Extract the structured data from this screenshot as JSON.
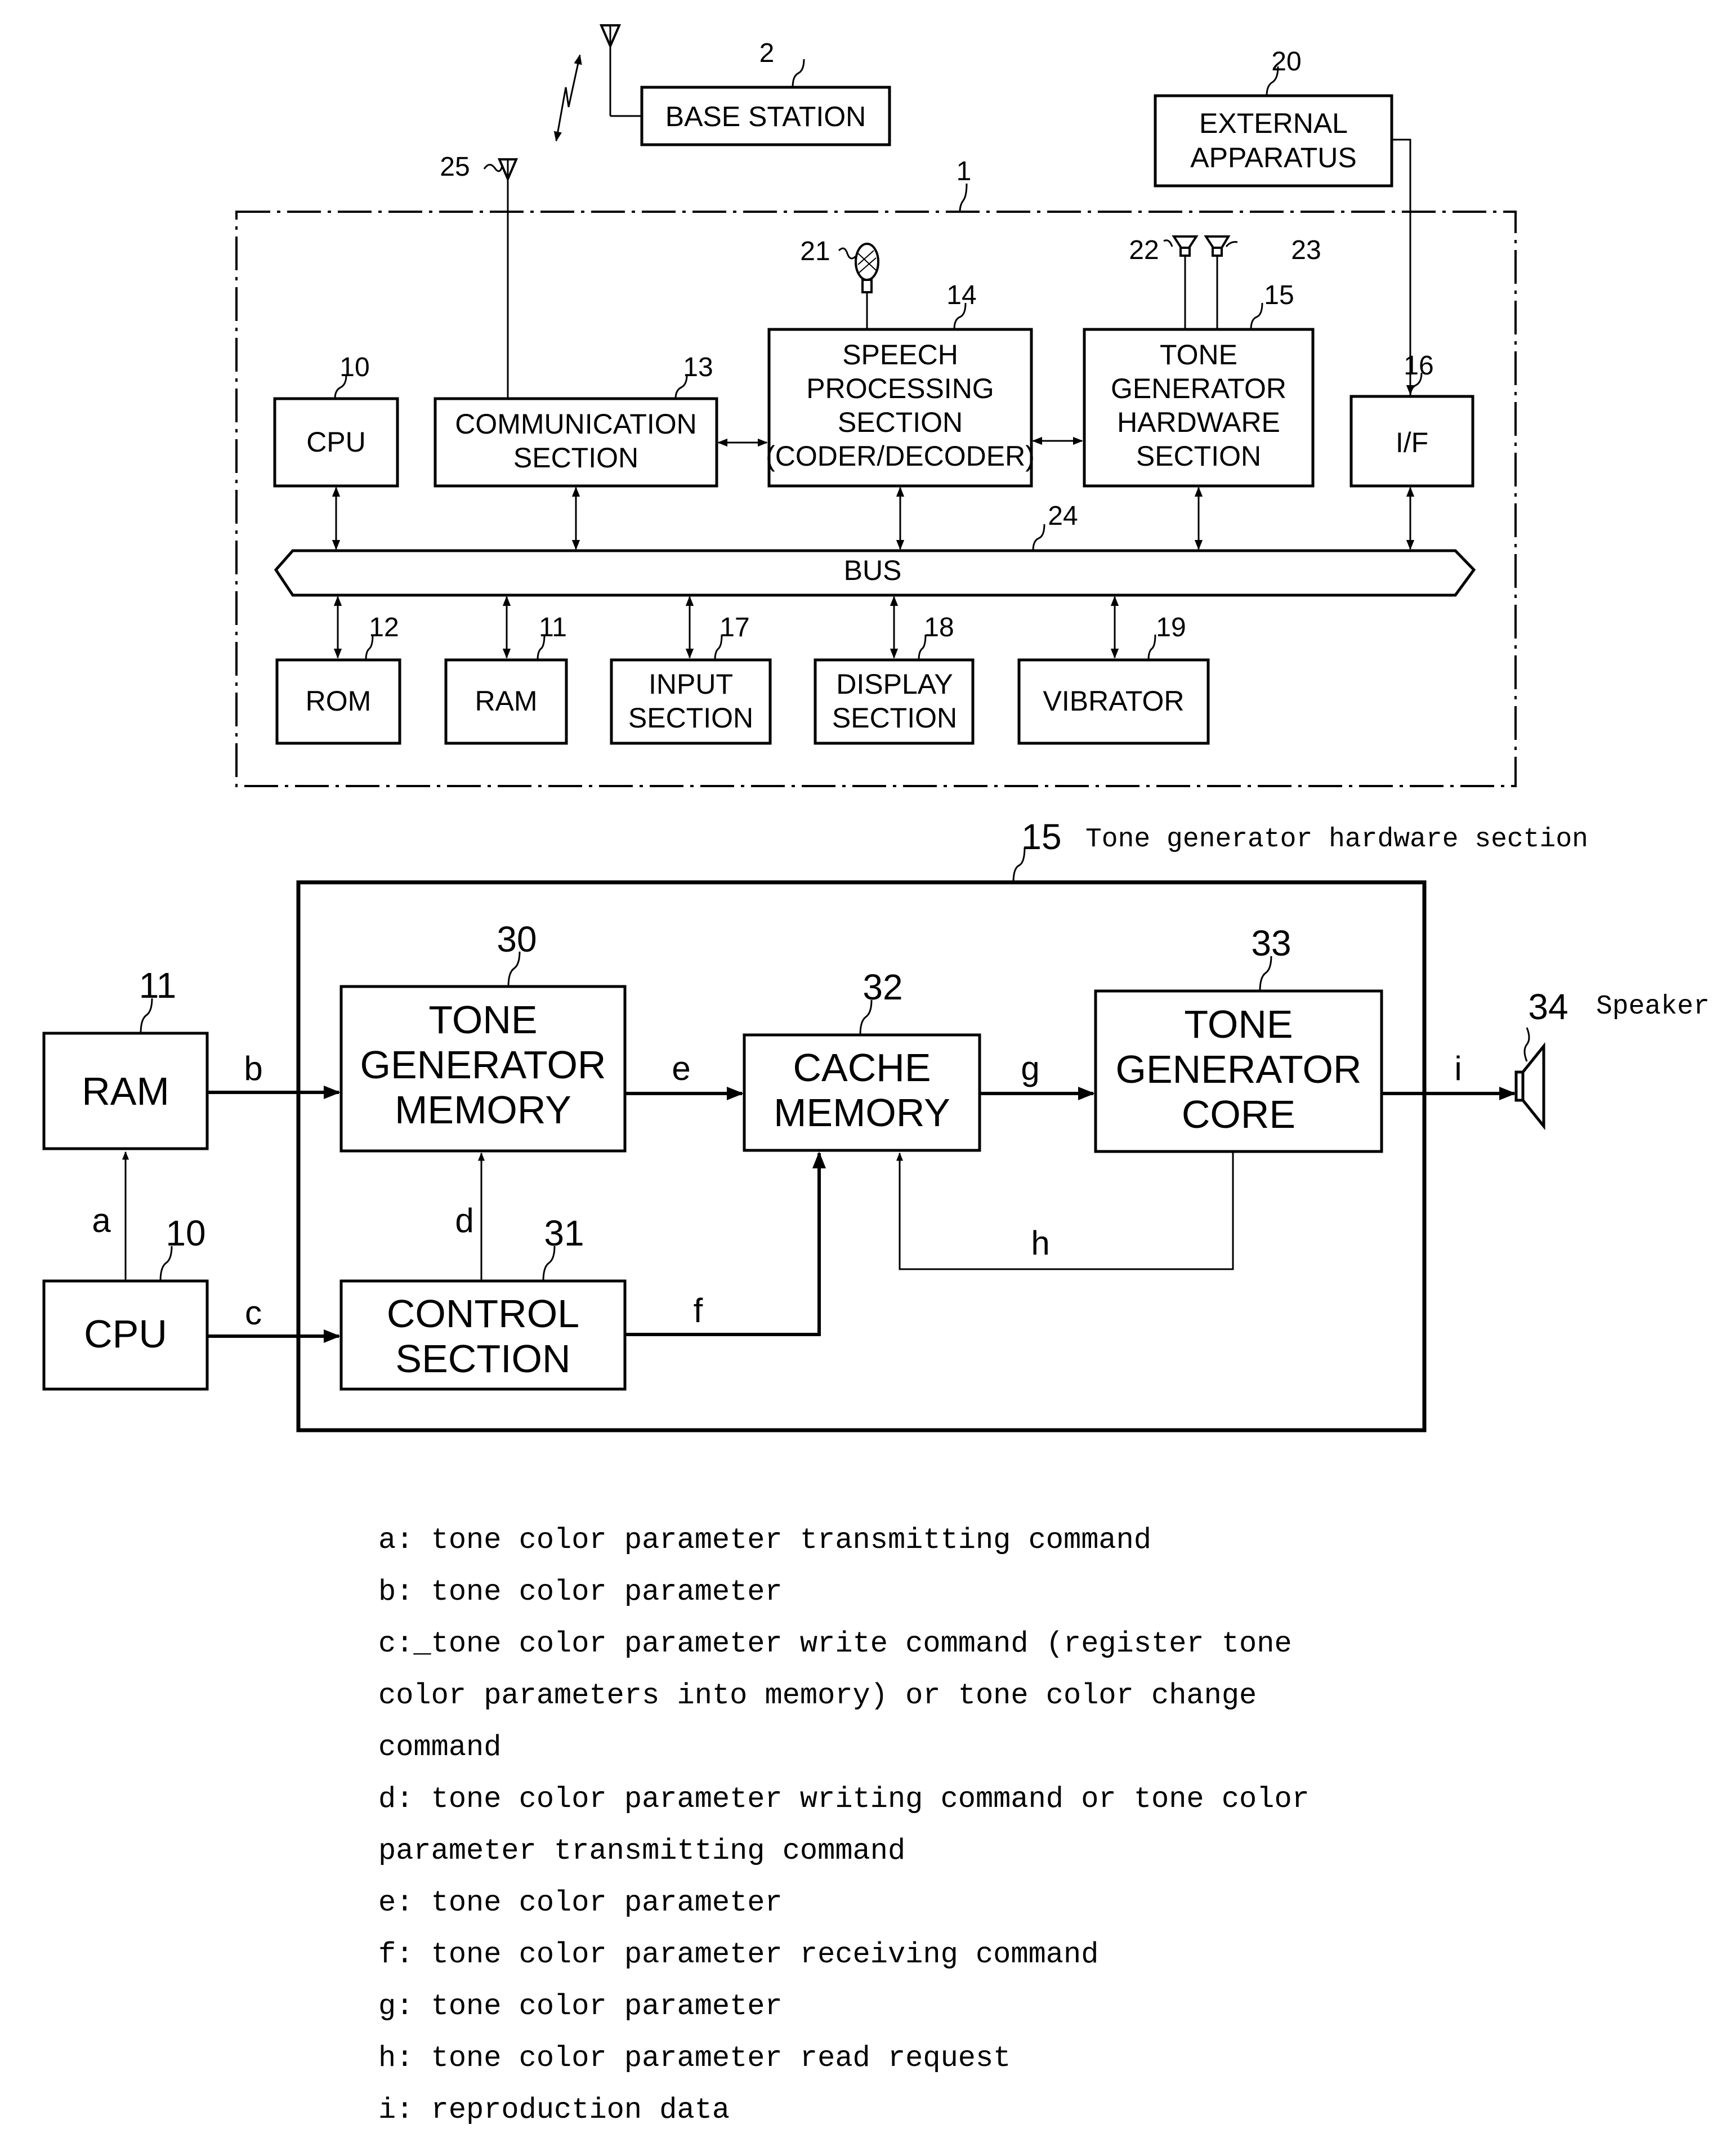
{
  "figure1": {
    "system_ref": "1",
    "base_station": {
      "ref": "2",
      "label": "BASE STATION"
    },
    "external_apparatus": {
      "ref": "20",
      "line1": "EXTERNAL",
      "line2": "APPARATUS"
    },
    "antenna_ref": "25",
    "microphone_ref": "21",
    "speaker_left_ref": "22",
    "speaker_right_ref": "23",
    "bus": {
      "ref": "24",
      "label": "BUS"
    },
    "blocks": {
      "cpu": {
        "ref": "10",
        "lines": [
          "CPU"
        ]
      },
      "communication": {
        "ref": "13",
        "lines": [
          "COMMUNICATION",
          "SECTION"
        ]
      },
      "speech": {
        "ref": "14",
        "lines": [
          "SPEECH",
          "PROCESSING",
          "SECTION",
          "(CODER/DECODER)"
        ]
      },
      "tone_hw": {
        "ref": "15",
        "lines": [
          "TONE",
          "GENERATOR",
          "HARDWARE",
          "SECTION"
        ]
      },
      "interface": {
        "ref": "16",
        "lines": [
          "I/F"
        ]
      },
      "rom": {
        "ref": "12",
        "lines": [
          "ROM"
        ]
      },
      "ram": {
        "ref": "11",
        "lines": [
          "RAM"
        ]
      },
      "input": {
        "ref": "17",
        "lines": [
          "INPUT",
          "SECTION"
        ]
      },
      "display": {
        "ref": "18",
        "lines": [
          "DISPLAY",
          "SECTION"
        ]
      },
      "vibrator": {
        "ref": "19",
        "lines": [
          "VIBRATOR"
        ]
      }
    }
  },
  "figure2": {
    "container": {
      "ref": "15",
      "caption": "Tone generator hardware section"
    },
    "blocks": {
      "ram": {
        "ref": "11",
        "lines": [
          "RAM"
        ]
      },
      "cpu": {
        "ref": "10",
        "lines": [
          "CPU"
        ]
      },
      "tg_memory": {
        "ref": "30",
        "lines": [
          "TONE",
          "GENERATOR",
          "MEMORY"
        ]
      },
      "control": {
        "ref": "31",
        "lines": [
          "CONTROL",
          "SECTION"
        ]
      },
      "cache": {
        "ref": "32",
        "lines": [
          "CACHE",
          "MEMORY"
        ]
      },
      "tg_core": {
        "ref": "33",
        "lines": [
          "TONE",
          "GENERATOR",
          "CORE"
        ]
      }
    },
    "speaker": {
      "ref": "34",
      "caption": "Speaker"
    },
    "signals": {
      "a": "a",
      "b": "b",
      "c": "c",
      "d": "d",
      "e": "e",
      "f": "f",
      "g": "g",
      "h": "h",
      "i": "i"
    }
  },
  "legend": [
    "a: tone color parameter transmitting command",
    "b: tone color parameter",
    "c:_tone color parameter write command (register tone",
    "color parameters into memory) or tone color change",
    "command",
    "d: tone color parameter writing command or tone color",
    "parameter transmitting command",
    "e: tone color parameter",
    "f: tone color parameter receiving command",
    "g: tone color parameter",
    "h: tone color parameter read request",
    "i: reproduction data"
  ]
}
